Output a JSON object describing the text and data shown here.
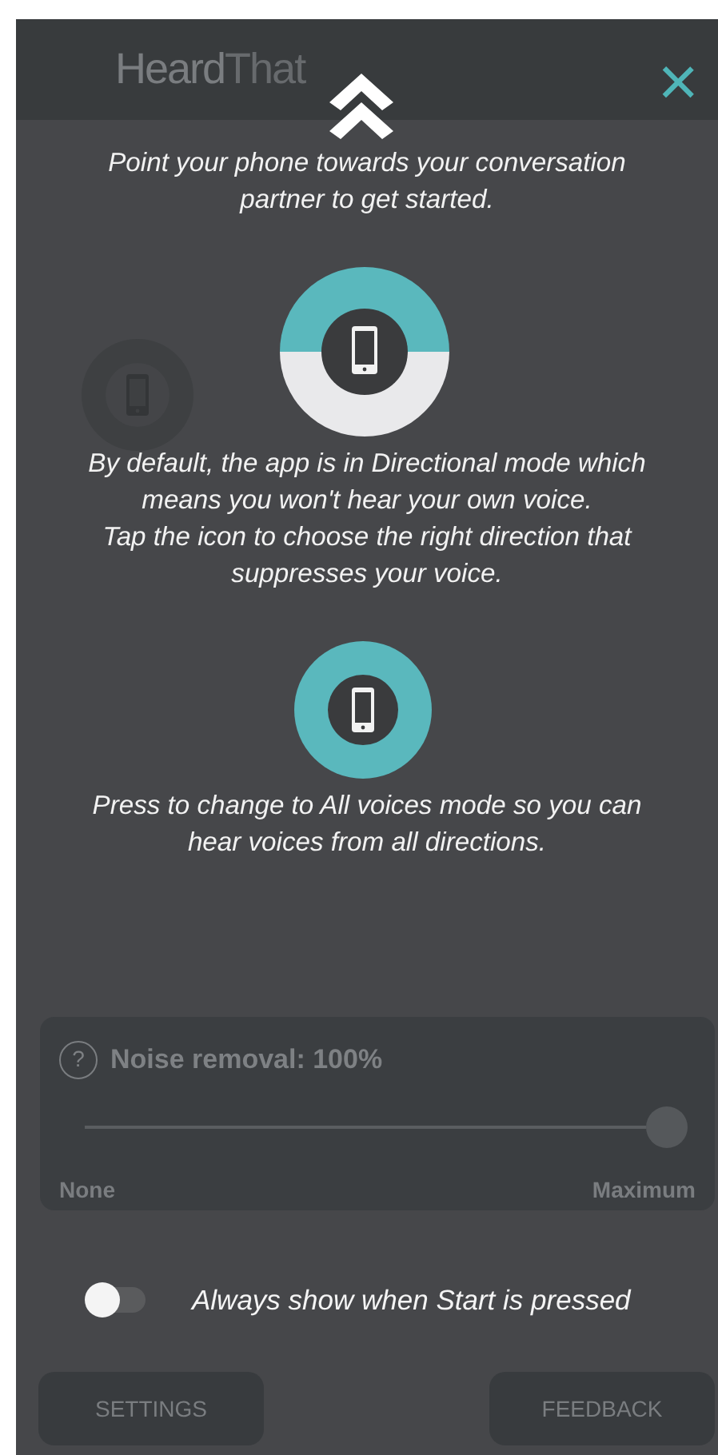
{
  "header": {
    "logo": [
      {
        "text": "Heard",
        "kind": "light"
      },
      {
        "text": "That",
        "kind": "dark"
      }
    ]
  },
  "noise_panel": {
    "help": "?",
    "label": "Noise removal: 100%",
    "level": 1,
    "min_label": "None",
    "max_label": "Maximum"
  },
  "buttons": [
    "SETTINGS",
    "FEEDBACK"
  ],
  "overlay": {
    "close": "×",
    "steps": [
      {
        "kind": "arrow",
        "text": "Point your phone towards your conversation partner to get started."
      },
      {
        "kind": "directional",
        "text": "By default, the app is in Directional mode which means you won't hear your own voice.\nTap the icon to choose the right direction that suppresses your voice."
      },
      {
        "kind": "all_voices",
        "text": "Press to change to All voices mode so you can hear voices from all directions."
      }
    ],
    "always_show": {
      "label": "Always show when Start is pressed",
      "on": false
    }
  }
}
